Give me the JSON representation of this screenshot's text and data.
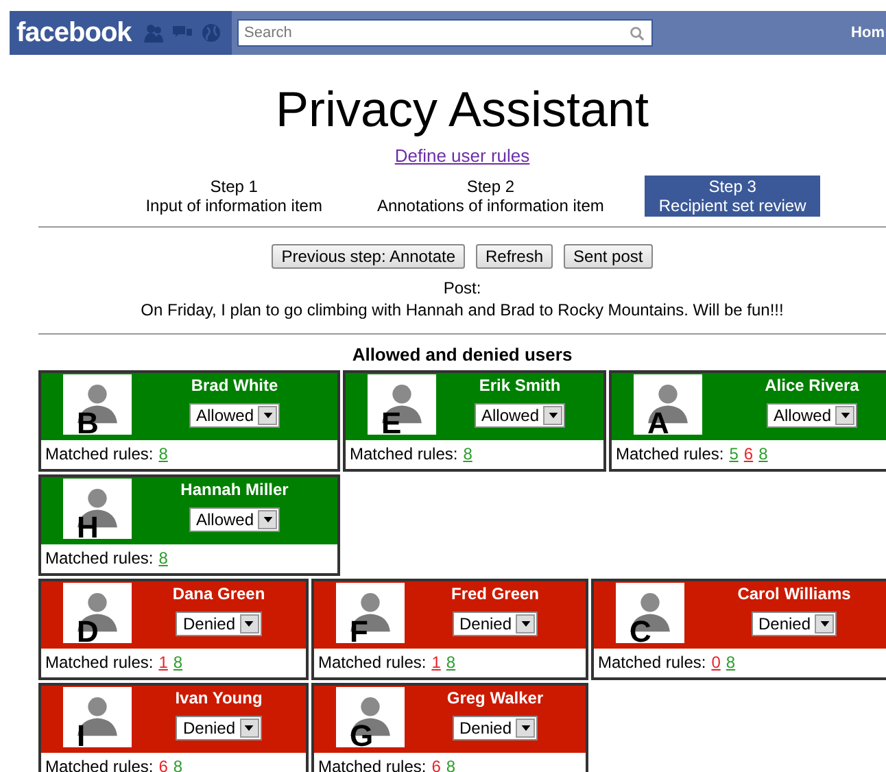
{
  "topbar": {
    "logo": "facebook",
    "search": {
      "placeholder": "Search"
    },
    "nav_link": "Hom"
  },
  "title": "Privacy Assistant",
  "rules_link": "Define user rules",
  "steps": [
    {
      "label": "Step 1",
      "caption": "Input of information item",
      "selected": false
    },
    {
      "label": "Step 2",
      "caption": "Annotations of information item",
      "selected": false
    },
    {
      "label": "Step 3",
      "caption": "Recipient set review",
      "selected": true
    }
  ],
  "buttons": [
    "Previous step: Annotate",
    "Refresh",
    "Sent post"
  ],
  "post": {
    "label": "Post:",
    "text": "On Friday, I plan to go climbing with Hannah and Brad to Rocky Mountains. Will be fun!!!"
  },
  "users_heading": "Allowed and denied users",
  "groups": [
    {
      "users": [
        {
          "name": "Brad White",
          "initial": "B",
          "allowed": true,
          "decision": "Allowed",
          "rules_label": "Matched rules:",
          "rules": [
            {
              "text": "8",
              "color": "#2e9e2e"
            }
          ]
        },
        {
          "name": "Erik Smith",
          "initial": "E",
          "allowed": true,
          "decision": "Allowed",
          "rules_label": "Matched rules:",
          "rules": [
            {
              "text": "8",
              "color": "#2e9e2e"
            }
          ]
        },
        {
          "name": "Alice Rivera",
          "initial": "A",
          "allowed": true,
          "decision": "Allowed",
          "rules_label": "Matched rules:",
          "rules": [
            {
              "text": "5",
              "color": "#2e9e2e"
            },
            {
              "text": "6",
              "color": "#e8242a"
            },
            {
              "text": "8",
              "color": "#2e9e2e"
            }
          ]
        },
        {
          "name": "Hannah Miller",
          "initial": "H",
          "allowed": true,
          "decision": "Allowed",
          "rules_label": "Matched rules:",
          "rules": [
            {
              "text": "8",
              "color": "#2e9e2e"
            }
          ]
        }
      ]
    },
    {
      "users": [
        {
          "name": "Dana Green",
          "initial": "D",
          "allowed": false,
          "decision": "Denied",
          "rules_label": "Matched rules:",
          "rules": [
            {
              "text": "1",
              "color": "#e8242a"
            },
            {
              "text": "8",
              "color": "#2e9e2e"
            }
          ]
        },
        {
          "name": "Fred Green",
          "initial": "F",
          "allowed": false,
          "decision": "Denied",
          "rules_label": "Matched rules:",
          "rules": [
            {
              "text": "1",
              "color": "#e8242a"
            },
            {
              "text": "8",
              "color": "#2e9e2e"
            }
          ]
        },
        {
          "name": "Carol Williams",
          "initial": "C",
          "allowed": false,
          "decision": "Denied",
          "rules_label": "Matched rules:",
          "rules": [
            {
              "text": "0",
              "color": "#e8242a"
            },
            {
              "text": "8",
              "color": "#2e9e2e"
            }
          ]
        },
        {
          "name": "Ivan Young",
          "initial": "I",
          "allowed": false,
          "decision": "Denied",
          "rules_label": "Matched rules:",
          "rules": [
            {
              "text": "6",
              "color": "#e8242a"
            },
            {
              "text": "8",
              "color": "#2e9e2e"
            }
          ]
        },
        {
          "name": "Greg Walker",
          "initial": "G",
          "allowed": false,
          "decision": "Denied",
          "rules_label": "Matched rules:",
          "rules": [
            {
              "text": "6",
              "color": "#e8242a"
            },
            {
              "text": "8",
              "color": "#2e9e2e"
            }
          ]
        }
      ]
    }
  ]
}
